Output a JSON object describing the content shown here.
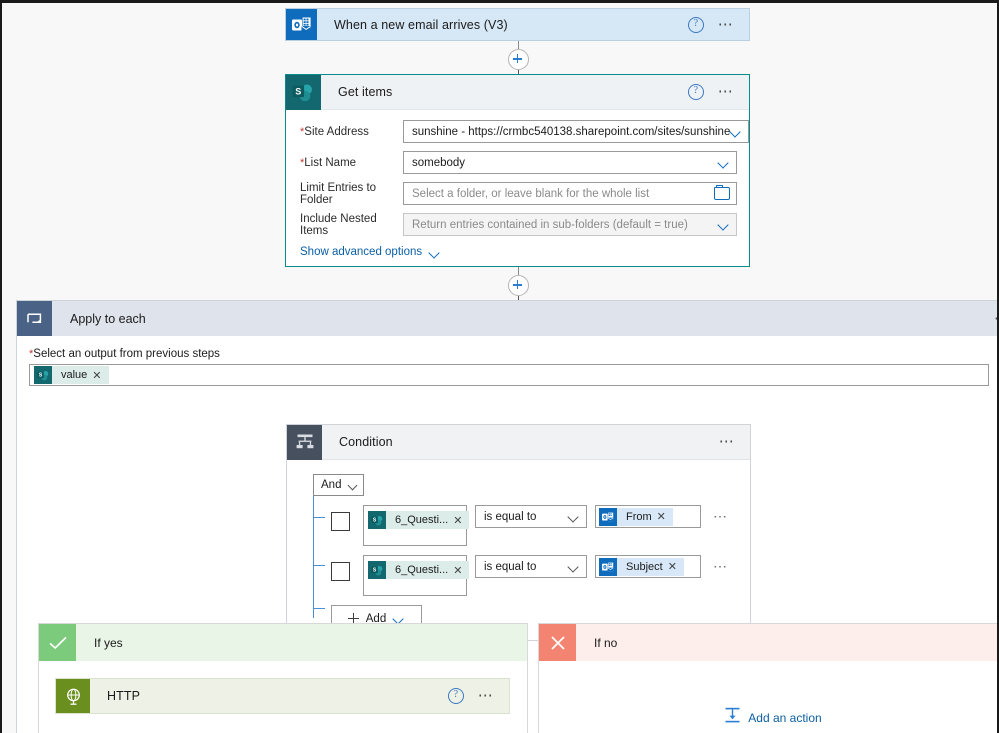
{
  "flow": {
    "trigger": {
      "title": "When a new email arrives (V3)",
      "icon": "outlook-icon",
      "help_icon": "help-icon",
      "more_icon": "more-options-icon"
    },
    "get_items": {
      "title": "Get items",
      "icon": "sharepoint-icon",
      "help_icon": "help-icon",
      "more_icon": "more-options-icon",
      "fields": [
        {
          "label": "Site Address",
          "required": true,
          "value": "sunshine - https://crmbc540138.sharepoint.com/sites/sunshine",
          "is_placeholder": false,
          "control": "dropdown"
        },
        {
          "label": "List Name",
          "required": true,
          "value": "somebody",
          "is_placeholder": false,
          "control": "dropdown"
        },
        {
          "label": "Limit Entries to Folder",
          "required": false,
          "value": "Select a folder, or leave blank for the whole list",
          "is_placeholder": true,
          "control": "folder-picker"
        },
        {
          "label": "Include Nested Items",
          "required": false,
          "value": "Return entries contained in sub-folders (default = true)",
          "is_placeholder": true,
          "control": "dropdown"
        }
      ],
      "advanced_options_label": "Show advanced options"
    },
    "apply_to_each": {
      "title": "Apply to each",
      "icon": "loop-icon",
      "more_icon": "more-options-icon",
      "output_label": "Select an output from previous steps",
      "output_required": true,
      "output_token": {
        "label": "value",
        "icon": "sharepoint-icon",
        "remove_icon": "close-icon"
      }
    },
    "condition": {
      "title": "Condition",
      "icon": "condition-icon",
      "more_icon": "more-options-icon",
      "logic_operator": "And",
      "rows": [
        {
          "checkbox_checked": false,
          "left_token": {
            "label": "6_Questi...",
            "icon": "sharepoint-icon",
            "remove_icon": "close-icon"
          },
          "operator": "is equal to",
          "right_token": {
            "label": "From",
            "icon": "outlook-icon",
            "remove_icon": "close-icon"
          },
          "more_icon": "more-options-icon"
        },
        {
          "checkbox_checked": false,
          "left_token": {
            "label": "6_Questi...",
            "icon": "sharepoint-icon",
            "remove_icon": "close-icon"
          },
          "operator": "is equal to",
          "right_token": {
            "label": "Subject",
            "icon": "outlook-icon",
            "remove_icon": "close-icon"
          },
          "more_icon": "more-options-icon"
        }
      ],
      "add_button": "Add"
    },
    "branch_yes": {
      "title": "If yes",
      "icon": "check-icon",
      "action": {
        "title": "HTTP",
        "icon": "http-globe-icon",
        "help_icon": "help-icon",
        "more_icon": "more-options-icon"
      }
    },
    "branch_no": {
      "title": "If no",
      "icon": "cross-icon",
      "add_action_label": "Add an action",
      "add_action_icon": "add-action-icon"
    },
    "connectors": [
      {
        "name": "insert-step-trigger-to-getitems",
        "icon": "plus-icon"
      },
      {
        "name": "insert-step-getitems-to-applyeach",
        "icon": "plus-icon"
      }
    ]
  },
  "colors": {
    "outlook_blue": "#0f6cbd",
    "sharepoint_teal": "#12686e",
    "condition_slate": "#47505e",
    "loop_slate": "#4a6285",
    "yes_green": "#7cca7c",
    "no_red": "#f38472",
    "http_olive": "#6b8f1e",
    "link_blue": "#0b5fa5"
  }
}
